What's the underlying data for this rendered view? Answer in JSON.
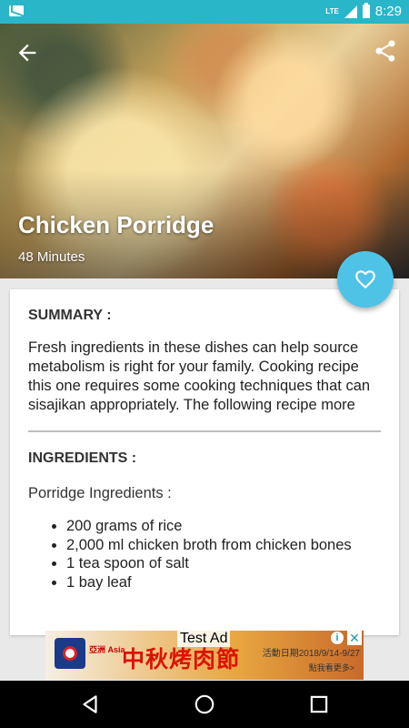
{
  "status_bar": {
    "time": "8:29",
    "network": "LTE"
  },
  "recipe": {
    "title": "Chicken Porridge",
    "duration": "48 Minutes"
  },
  "summary": {
    "heading": "SUMMARY :",
    "text": "Fresh ingredients in these dishes can help source metabolism is right for your family. Cooking recipe this one requires some cooking techniques that can sisajikan appropriately. The following recipe more"
  },
  "ingredients": {
    "heading": "INGREDIENTS :",
    "subheading": "Porridge Ingredients :",
    "items": [
      "200 grams of rice",
      "2,000 ml chicken broth from chicken bones",
      "1 tea spoon of salt",
      "1 bay leaf"
    ]
  },
  "ad": {
    "label": "Test Ad",
    "brand": "亞洲 Asia",
    "headline": "中秋烤肉節",
    "date_text": "活動日期2018/9/14-9/27",
    "more_text": "點我看更多>",
    "info_icon": "i",
    "close_icon": "✕"
  },
  "icons": {
    "back": "arrow-left-icon",
    "share": "share-icon",
    "favorite": "heart-outline-icon"
  },
  "colors": {
    "status_bar": "#29b6c9",
    "fab": "#4fc3e6"
  }
}
